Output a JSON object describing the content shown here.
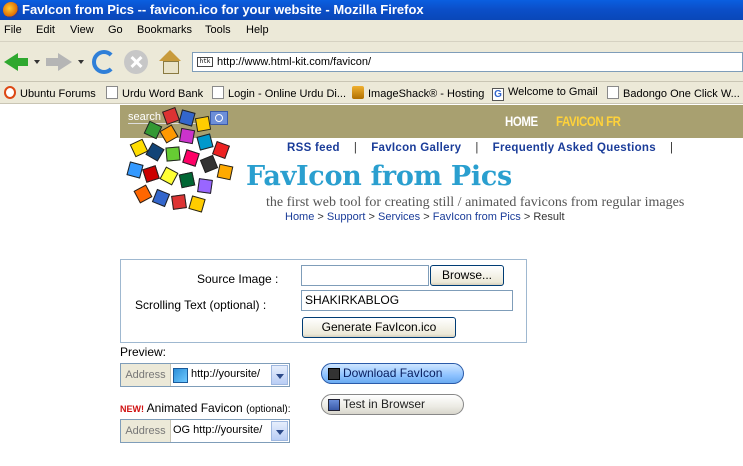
{
  "window": {
    "title": "FavIcon from Pics -- favicon.ico for your website - Mozilla Firefox"
  },
  "menu": [
    "File",
    "Edit",
    "View",
    "Go",
    "Bookmarks",
    "Tools",
    "Help"
  ],
  "address_bar": {
    "url": "http://www.html-kit.com/favicon/",
    "icon_text": "htk"
  },
  "bookmarks": [
    {
      "label": "Ubuntu Forums",
      "icon": "ubuntu-icon"
    },
    {
      "label": "Urdu Word Bank",
      "icon": "page-icon"
    },
    {
      "label": "Login - Online Urdu Di...",
      "icon": "page-icon"
    },
    {
      "label": "ImageShack® - Hosting",
      "icon": "imageshack-icon"
    },
    {
      "label": "Welcome to Gmail",
      "icon": "gmail-icon"
    },
    {
      "label": "Badongo One Click W...",
      "icon": "page-icon"
    }
  ],
  "site": {
    "search_placeholder": "search",
    "top_nav": {
      "home": "HOME",
      "favicon": "FAVICON FR"
    },
    "links": {
      "rss": "RSS feed",
      "gallery": "FavIcon Gallery",
      "faq": "Frequently Asked Questions",
      "sep": "|"
    },
    "title": "FavIcon from Pics",
    "tagline": "the first web tool for creating still / animated favicons from regular images",
    "breadcrumb": {
      "home": "Home",
      "support": "Support",
      "services": "Services",
      "favicon_from_pics": "FavIcon from Pics",
      "result": "Result",
      "sep": ">"
    }
  },
  "form": {
    "source_label": "Source Image :",
    "source_value": "",
    "browse_label": "Browse...",
    "scroll_label": "Scrolling Text (optional) :",
    "scroll_value": "SHAKIRKABLOG",
    "generate_label": "Generate FavIcon.ico"
  },
  "preview": {
    "label": "Preview:",
    "address_label": "Address",
    "address_value": "http://yoursite/",
    "download_label": "Download FavIcon",
    "test_label": "Test in Browser",
    "new_badge": "NEW!",
    "animated_label": "Animated Favicon",
    "animated_optional": "(optional):",
    "animated_address_value": "OG http://yoursite/"
  }
}
